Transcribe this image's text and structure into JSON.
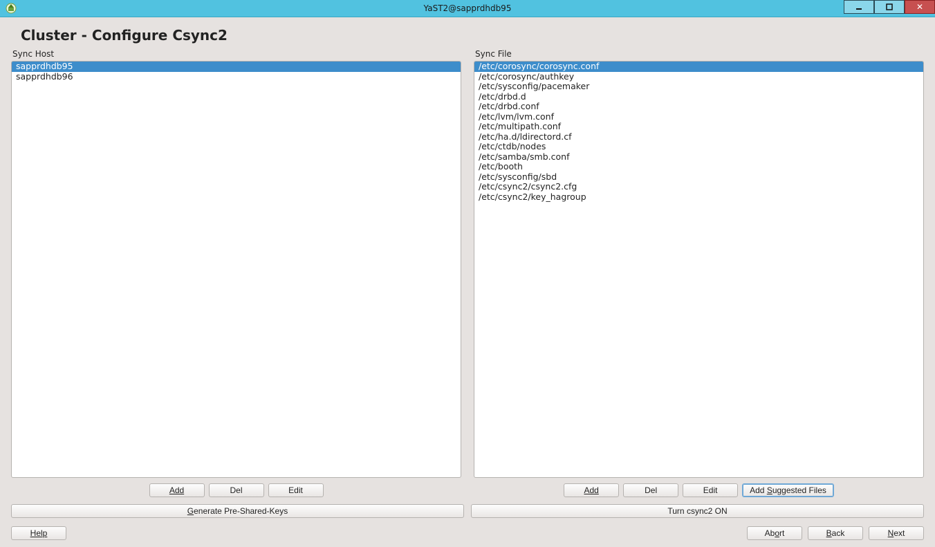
{
  "window": {
    "title": "YaST2@sapprdhdb95"
  },
  "heading": "Cluster - Configure Csync2",
  "panels": {
    "host": {
      "label": "Sync Host",
      "items": [
        "sapprdhdb95",
        "sapprdhdb96"
      ],
      "selected_index": 0,
      "buttons": {
        "add": "Add",
        "del": "Del",
        "edit": "Edit"
      }
    },
    "file": {
      "label": "Sync File",
      "items": [
        "/etc/corosync/corosync.conf",
        "/etc/corosync/authkey",
        "/etc/sysconfig/pacemaker",
        "/etc/drbd.d",
        "/etc/drbd.conf",
        "/etc/lvm/lvm.conf",
        "/etc/multipath.conf",
        "/etc/ha.d/ldirectord.cf",
        "/etc/ctdb/nodes",
        "/etc/samba/smb.conf",
        "/etc/booth",
        "/etc/sysconfig/sbd",
        "/etc/csync2/csync2.cfg",
        "/etc/csync2/key_hagroup"
      ],
      "selected_index": 0,
      "buttons": {
        "add": "Add",
        "del": "Del",
        "edit": "Edit",
        "suggested": "Add Suggested Files"
      }
    }
  },
  "wide_buttons": {
    "generate_keys": "Generate Pre-Shared-Keys",
    "turn_on": "Turn csync2 ON"
  },
  "footer": {
    "help": "Help",
    "abort": "Abort",
    "back": "Back",
    "next": "Next"
  }
}
